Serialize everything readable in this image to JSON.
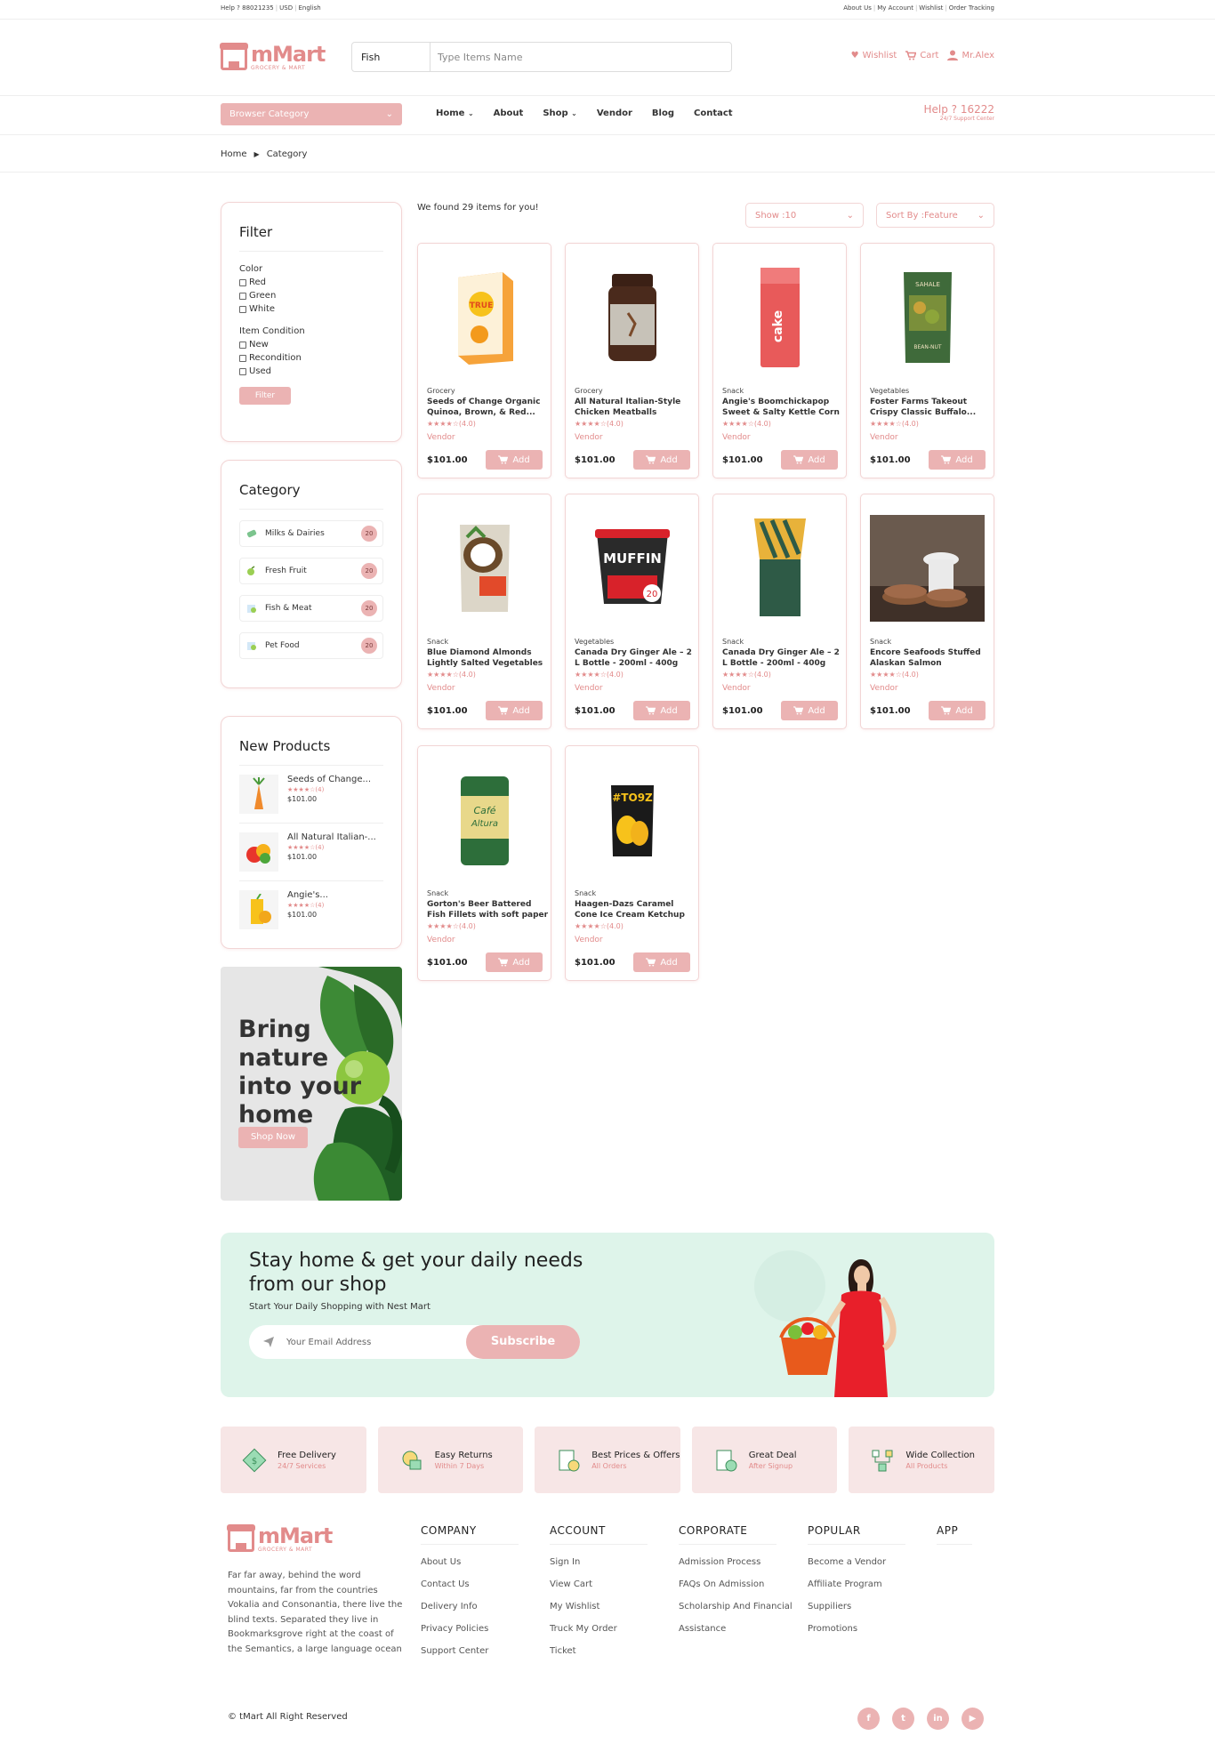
{
  "topbar": {
    "help": "Help ? 88021235",
    "currency": "USD",
    "language": "English",
    "links": [
      "About Us",
      "My Account",
      "Wishlist",
      "Order Tracking"
    ]
  },
  "brand": {
    "name": "mMart",
    "tagline": "GROCERY & MART"
  },
  "search": {
    "category": "Fish",
    "placeholder": "Type Items Name"
  },
  "header": {
    "wishlist": "Wishlist",
    "cart": "Cart",
    "user": "Mr.Alex"
  },
  "nav": {
    "browse": "Browser Category",
    "links": [
      "Home",
      "About",
      "Shop",
      "Vendor",
      "Blog",
      "Contact"
    ],
    "help_title": "Help ? 16222",
    "help_sub": "24/7 Support Center"
  },
  "breadcrumb": [
    "Home",
    "Category"
  ],
  "filter": {
    "title": "Filter",
    "color_label": "Color",
    "colors": [
      "Red",
      "Green",
      "White"
    ],
    "cond_label": "Item Condition",
    "conditions": [
      "New",
      "Recondition",
      "Used"
    ],
    "button": "Filter"
  },
  "category": {
    "title": "Category",
    "items": [
      {
        "label": "Milks & Dairies",
        "count": "20"
      },
      {
        "label": "Fresh Fruit",
        "count": "20"
      },
      {
        "label": "Fish & Meat",
        "count": "20"
      },
      {
        "label": "Pet Food",
        "count": "20"
      }
    ]
  },
  "new_products": {
    "title": "New Products",
    "items": [
      {
        "name": "Seeds of Change...",
        "rating": "(4)",
        "price": "$101.00"
      },
      {
        "name": "All Natural Italian-...",
        "rating": "(4)",
        "price": "$101.00"
      },
      {
        "name": "Angie's...",
        "rating": "(4)",
        "price": "$101.00"
      }
    ]
  },
  "promo": {
    "text": "Bring nature into your home",
    "button": "Shop Now"
  },
  "results": {
    "found": "We found 29 items for you!",
    "show": "Show :10",
    "sort": "Sort By :Feature"
  },
  "products": [
    {
      "cat": "Grocery",
      "title": "Seeds of Change Organic Quinoa, Brown, & Red...",
      "rating": "(4.0)",
      "vendor": "Vendor",
      "price": "$101.00",
      "add": "Add",
      "img": "box-orange"
    },
    {
      "cat": "Grocery",
      "title": "All Natural Italian-Style Chicken Meatballs",
      "rating": "(4.0)",
      "vendor": "Vendor",
      "price": "$101.00",
      "add": "Add",
      "img": "jar"
    },
    {
      "cat": "Snack",
      "title": "Angie's Boomchickapop Sweet & Salty Kettle Corn",
      "rating": "(4.0)",
      "vendor": "Vendor",
      "price": "$101.00",
      "add": "Add",
      "img": "bag-red"
    },
    {
      "cat": "Vegetables",
      "title": "Foster Farms Takeout Crispy Classic Buffalo...",
      "rating": "(4.0)",
      "vendor": "Vendor",
      "price": "$101.00",
      "add": "Add",
      "img": "bag-green"
    },
    {
      "cat": "Snack",
      "title": "Blue Diamond Almonds Lightly Salted Vegetables",
      "rating": "(4.0)",
      "vendor": "Vendor",
      "price": "$101.00",
      "add": "Add",
      "img": "bag-coconut"
    },
    {
      "cat": "Vegetables",
      "title": "Canada Dry Ginger Ale – 2 L Bottle - 200ml - 400g",
      "rating": "(4.0)",
      "vendor": "Vendor",
      "price": "$101.00",
      "add": "Add",
      "img": "cup-muffin"
    },
    {
      "cat": "Snack",
      "title": "Canada Dry Ginger Ale – 2 L Bottle - 200ml - 400g",
      "rating": "(4.0)",
      "vendor": "Vendor",
      "price": "$101.00",
      "add": "Add",
      "img": "bag-stripe"
    },
    {
      "cat": "Snack",
      "title": "Encore Seafoods Stuffed Alaskan Salmon",
      "rating": "(4.0)",
      "vendor": "Vendor",
      "price": "$101.00",
      "add": "Add",
      "img": "cookies"
    },
    {
      "cat": "Snack",
      "title": "Gorton's Beer Battered Fish Fillets with soft paper",
      "rating": "(4.0)",
      "vendor": "Vendor",
      "price": "$101.00",
      "add": "Add",
      "img": "can-coffee"
    },
    {
      "cat": "Snack",
      "title": "Haagen-Dazs Caramel Cone Ice Cream Ketchup",
      "rating": "(4.0)",
      "vendor": "Vendor",
      "price": "$101.00",
      "add": "Add",
      "img": "chips"
    }
  ],
  "newsletter": {
    "title": "Stay home & get your daily needs from our shop",
    "sub": "Start Your Daily Shopping with Nest Mart",
    "placeholder": "Your Email Address",
    "button": "Subscribe"
  },
  "features": [
    {
      "title": "Free Delivery",
      "sub": "24/7 Services"
    },
    {
      "title": "Easy Returns",
      "sub": "Within 7 Days"
    },
    {
      "title": "Best Prices & Offers",
      "sub": "All Orders"
    },
    {
      "title": "Great Deal",
      "sub": "After Signup"
    },
    {
      "title": "Wide Collection",
      "sub": "All Products"
    }
  ],
  "footer": {
    "about": "Far far away, behind the word mountains, far from the countries Vokalia and Consonantia, there live the blind texts. Separated they live in Bookmarksgrove right at the coast of the Semantics, a large language ocean",
    "columns": [
      {
        "title": "COMPANY",
        "links": [
          "About Us",
          "Contact Us",
          "Delivery Info",
          "Privacy Policies",
          "Support Center"
        ]
      },
      {
        "title": "ACCOUNT",
        "links": [
          "Sign In",
          "View Cart",
          "My Wishlist",
          "Truck My Order",
          "Ticket"
        ]
      },
      {
        "title": "CORPORATE",
        "links": [
          "Admission Process",
          "FAQs On Admission",
          "Scholarship And Financial",
          "Assistance"
        ]
      },
      {
        "title": "POPULAR",
        "links": [
          "Become a Vendor",
          "Affiliate Program",
          "Suppiliers",
          "Promotions"
        ]
      },
      {
        "title": "APP",
        "links": []
      }
    ],
    "copyright": "© tMart All Right Reserved",
    "socials": [
      "f",
      "t",
      "in",
      "▶"
    ]
  },
  "colors": {
    "accent": "#e28b8b",
    "accent_light": "#ebb3b3",
    "newsletter_bg": "#def4ea",
    "feature_bg": "#f7e6e6"
  }
}
